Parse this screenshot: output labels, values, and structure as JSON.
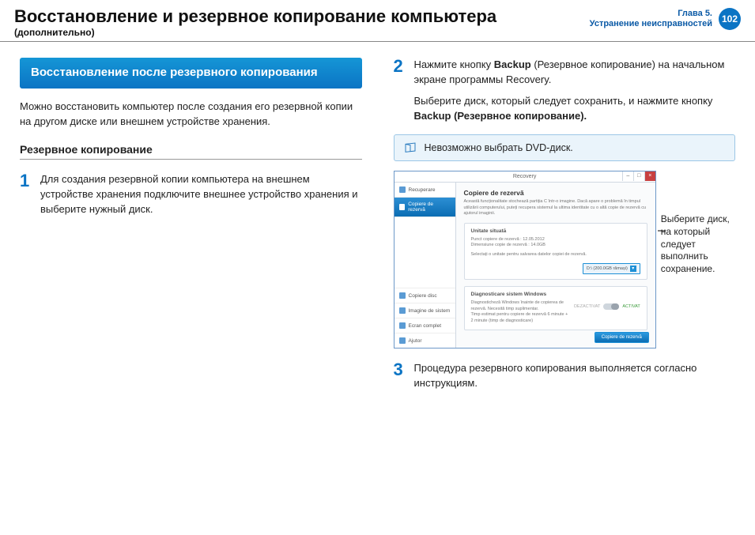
{
  "header": {
    "title": "Восстановление и резервное копирование компьютера",
    "subtitle": "(дополнительно)",
    "chapter_line1": "Глава 5.",
    "chapter_line2": "Устранение неисправностей",
    "page_number": "102"
  },
  "left": {
    "section_box": "Восстановление после резервного копирования",
    "intro": "Можно восстановить компьютер после создания его резервной копии на другом диске или внешнем устройстве хранения.",
    "h3": "Резервное копирование",
    "step1_num": "1",
    "step1_text": "Для создания резервной копии компьютера на внешнем устройстве хранения подключите внешнее устройство хранения и выберите нужный диск."
  },
  "right": {
    "step2_num": "2",
    "step2_pre": "Нажмите кнопку ",
    "step2_bold1": "Backup",
    "step2_mid": " (Резервное копирование) на начальном экране программы Recovery.",
    "step2_line2_pre": "Выберите диск, который следует сохранить, и нажмите кнопку ",
    "step2_line2_bold": "Backup (Резервное копирование).",
    "note": "Невозможно выбрать DVD-диск.",
    "callout": "Выберите диск, на который следует выполнить сохранение.",
    "step3_num": "3",
    "step3_text": "Процедура резервного копирования выполняется согласно инструкциям."
  },
  "app": {
    "title": "Recovery",
    "side_recover": "Recuperare",
    "side_backup": "Copiere de rezervă",
    "side_copy": "Copiere disc",
    "side_image": "Imagine de sistem",
    "side_exit": "Ecran complet",
    "side_help": "Ajutor",
    "main_title": "Copiere de rezervă",
    "main_desc": "Această funcționalitate stochează partiția C într-o imagine. Dacă apare o problemă în timpul utilizării computerului, puteți recupera sistemul la ultima identitate cu o altă copie de rezervă cu ajutorul imaginii.",
    "panel1_title": "Unitate situată",
    "panel1_l1": "Punct copiere de rezervă : 12.05.2012",
    "panel1_l2": "Dimensiune copie de rezervă : 14.0GB",
    "panel1_l3": "Selectați o unitate pentru salvarea datelor copiei de rezervă.",
    "drive": "D:\\ (200.0GB rămași)",
    "panel2_title": "Diagnosticare sistem Windows",
    "panel2_l1": "Diagnosticheză Windows înainte de copierea de rezervă. Necesită timp suplimentar.",
    "panel2_l2": "Timp estimat pentru copiere de rezervă 6 minute + 2 minute (timp de diagnosticare)",
    "toggle_off": "DEZACTIVAT",
    "toggle_on": "ACTIVAT",
    "button": "Copiere de rezervă"
  }
}
